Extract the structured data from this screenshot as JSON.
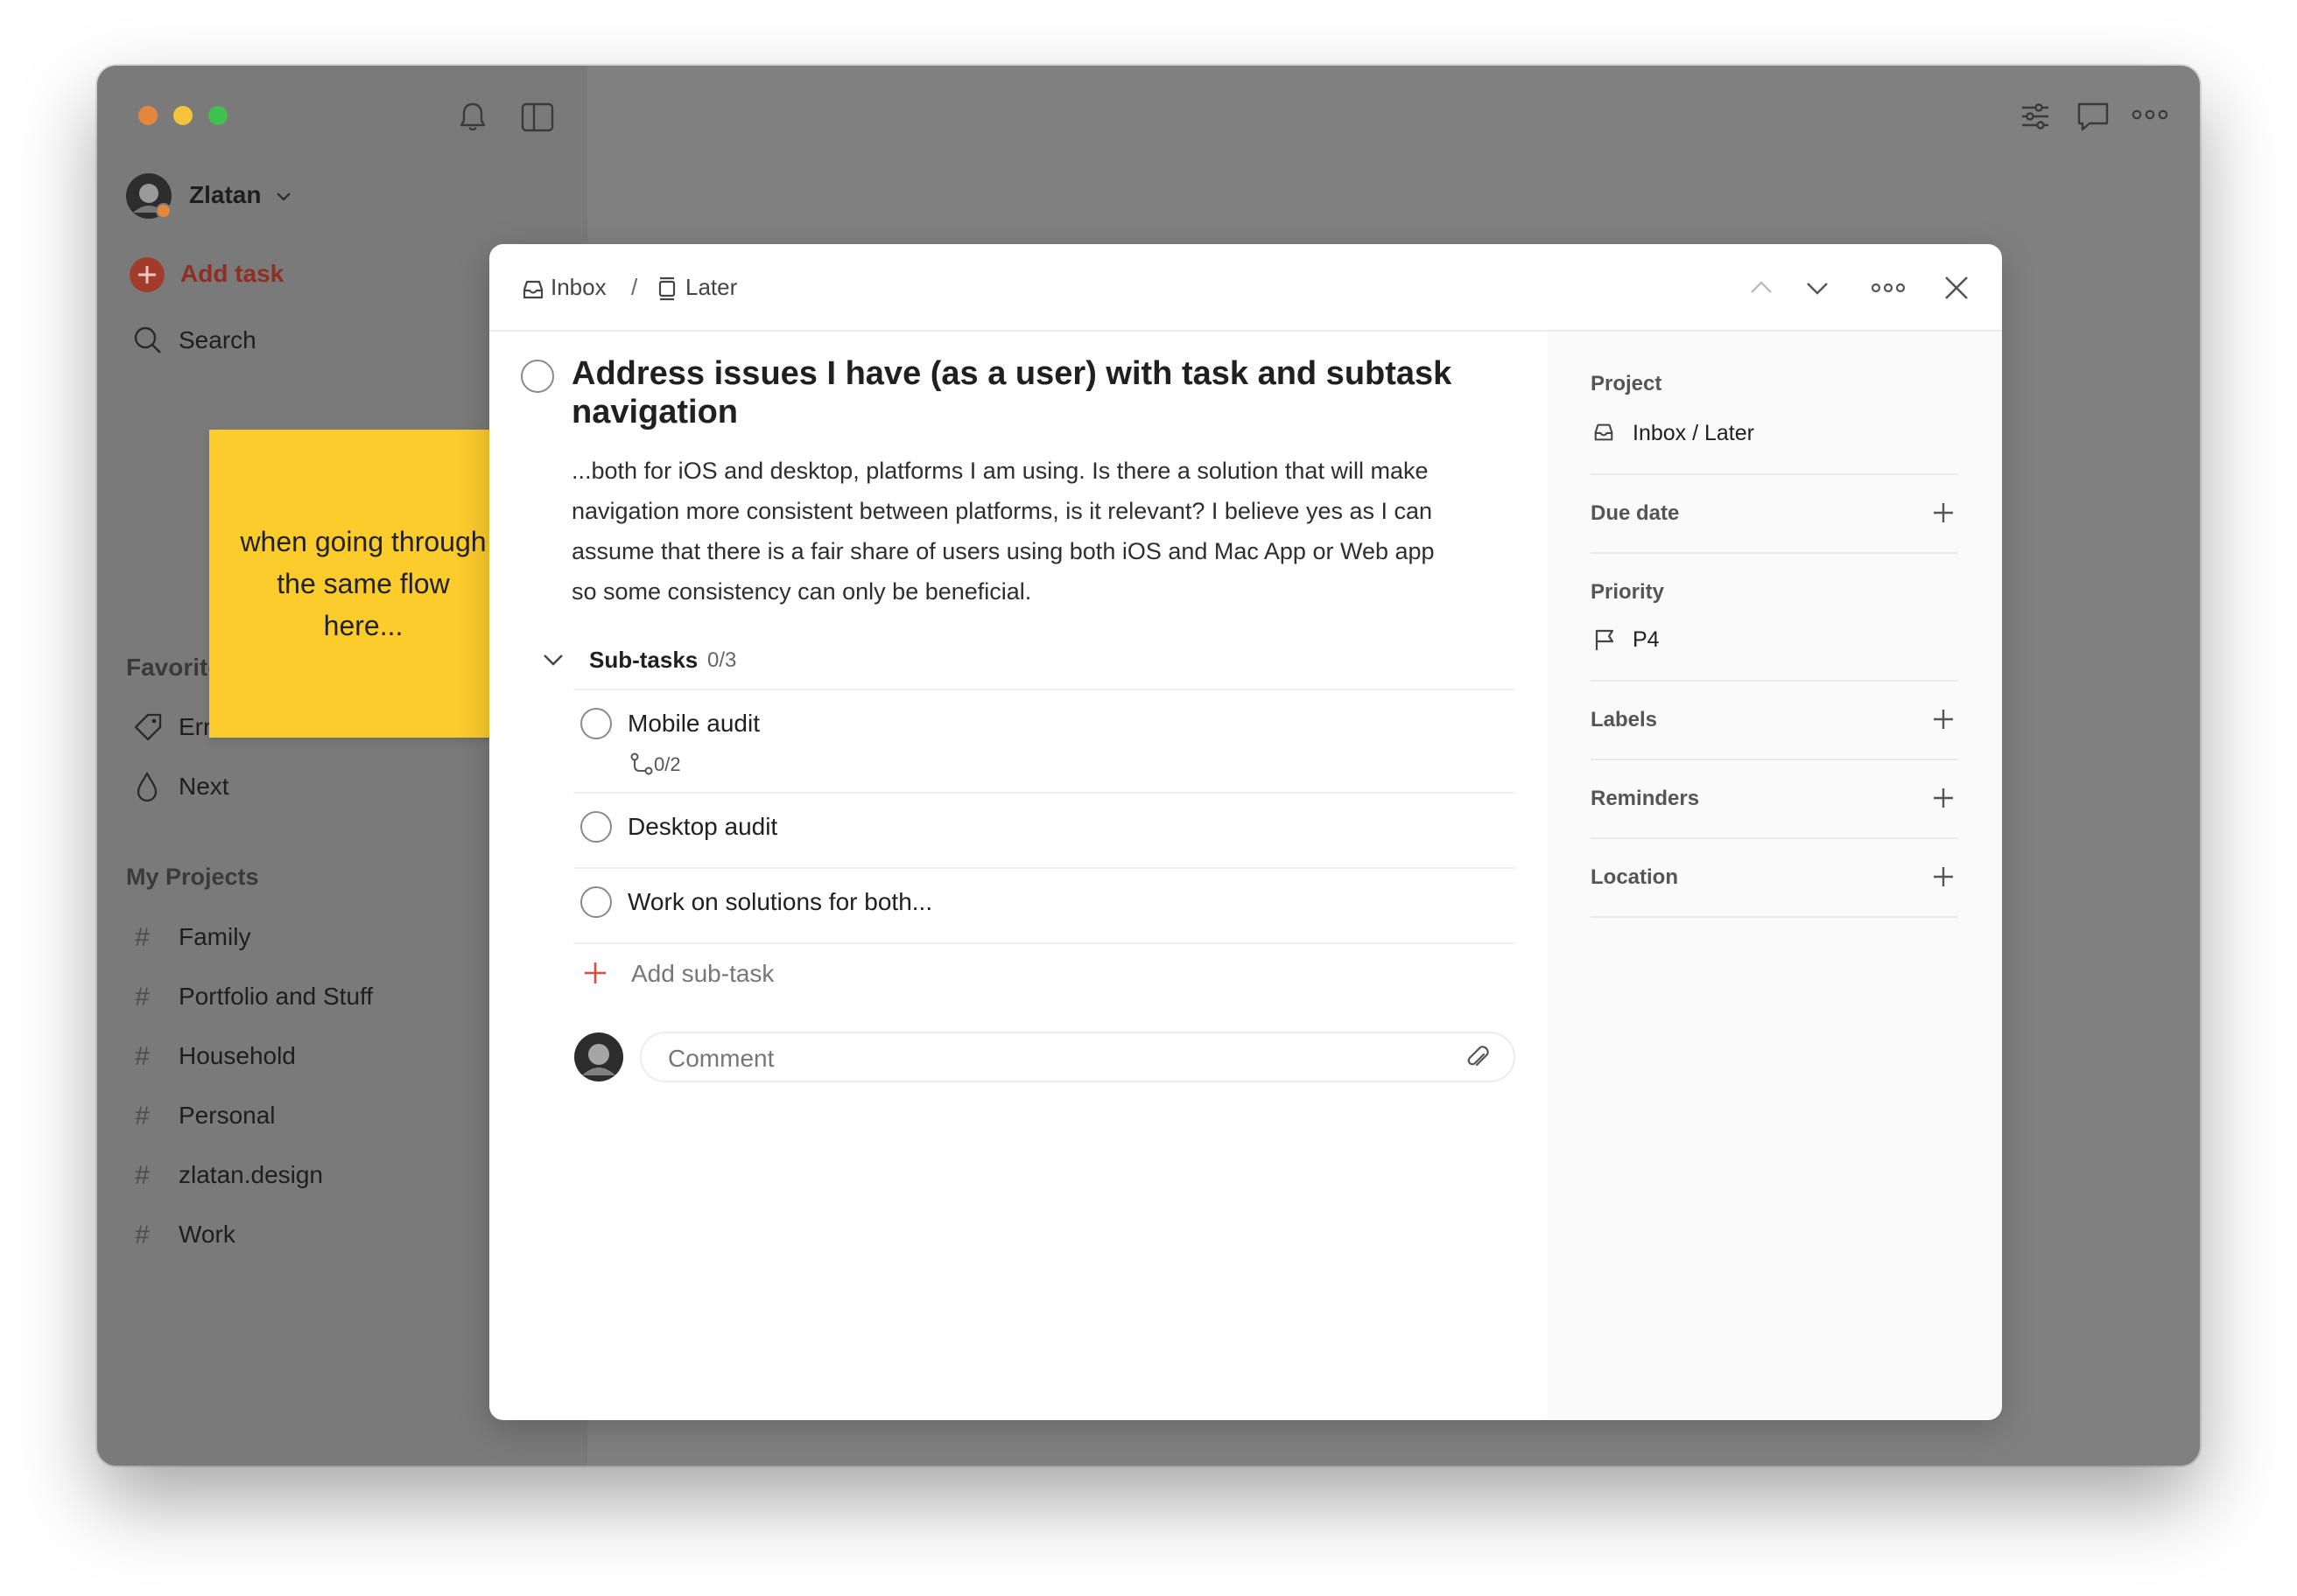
{
  "sidebar": {
    "user_name": "Zlatan",
    "add_task": "Add task",
    "search": "Search",
    "favorites_heading": "Favorites",
    "favorites": [
      {
        "label": "Errand",
        "icon": "tag-icon"
      },
      {
        "label": "Next",
        "icon": "drop-icon"
      }
    ],
    "projects_heading": "My Projects",
    "projects": [
      "Family",
      "Portfolio and Stuff",
      "Household",
      "Personal",
      "zlatan.design",
      "Work"
    ],
    "hash": "#"
  },
  "sticky_note": "when going through the same flow here...",
  "task": {
    "breadcrumb": {
      "inbox": "Inbox",
      "separator": "/",
      "section": "Later"
    },
    "title": "Address issues I have (as a user) with task and subtask navigation",
    "description_lines": [
      "...both for iOS and desktop, platforms I am using. Is there a solution that will make",
      "navigation more consistent between platforms, is it relevant? I believe yes as I can",
      "assume that there is a fair share of users using both iOS and Mac App or Web app",
      "so some consistency can only be beneficial."
    ],
    "subtasks_label": "Sub-tasks",
    "subtasks_count": "0/3",
    "subtasks": [
      {
        "title": "Mobile audit",
        "meta": "0/2"
      },
      {
        "title": "Desktop audit",
        "meta": ""
      },
      {
        "title": "Work on solutions for both...",
        "meta": ""
      }
    ],
    "add_subtask": "Add sub-task",
    "comment_placeholder": "Comment"
  },
  "details": {
    "project_label": "Project",
    "project_value": "Inbox / Later",
    "due_date_label": "Due date",
    "priority_label": "Priority",
    "priority_value": "P4",
    "labels_label": "Labels",
    "reminders_label": "Reminders",
    "location_label": "Location"
  },
  "colors": {
    "accent": "#dc4c3e",
    "sticky": "#fccb2c",
    "overlay": "#808080",
    "traffic_red": "#e3873d",
    "traffic_yellow": "#f5c43a",
    "traffic_green": "#3fc04f"
  }
}
